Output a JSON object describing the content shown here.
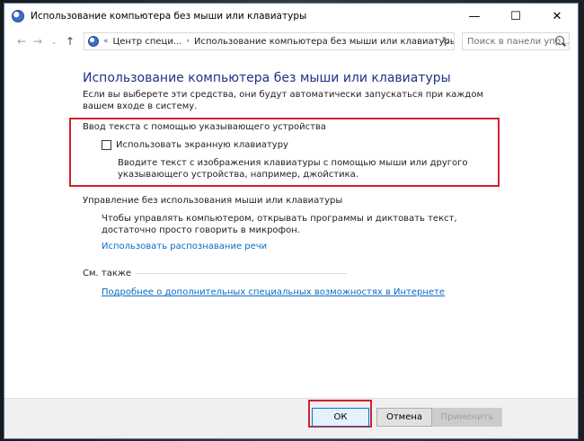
{
  "window": {
    "title": "Использование компьютера без мыши или клавиатуры",
    "controls": {
      "minimize": "—",
      "maximize": "☐",
      "close": "✕"
    }
  },
  "address_bar": {
    "breadcrumbs": [
      "Центр специ...",
      "Использование компьютера без мыши или клавиатуры"
    ],
    "search_placeholder": "Поиск в панели упр..."
  },
  "main": {
    "title": "Использование компьютера без мыши или клавиатуры",
    "intro": "Если вы выберете эти средства, они будут автоматически запускаться при каждом вашем входе в систему.",
    "section_pointer": {
      "header": "Ввод текста с помощью указывающего устройства",
      "checkbox_label": "Использовать экранную клавиатуру",
      "checkbox_checked": false,
      "description": "Вводите текст с изображения клавиатуры с помощью мыши или другого указывающего устройства, например, джойстика."
    },
    "section_speech": {
      "header": "Управление без использования мыши или клавиатуры",
      "description": "Чтобы управлять компьютером, открывать программы и диктовать текст, достаточно просто говорить в микрофон.",
      "link": "Использовать распознавание речи"
    },
    "section_see_also": {
      "header": "См. также",
      "link": "Подробнее о дополнительных специальных возможностях в Интернете"
    }
  },
  "buttons": {
    "ok": "ОК",
    "cancel": "Отмена",
    "apply": "Применить"
  },
  "colors": {
    "highlight": "#d0222e",
    "title": "#1e3287",
    "link": "#0a6bc2"
  }
}
